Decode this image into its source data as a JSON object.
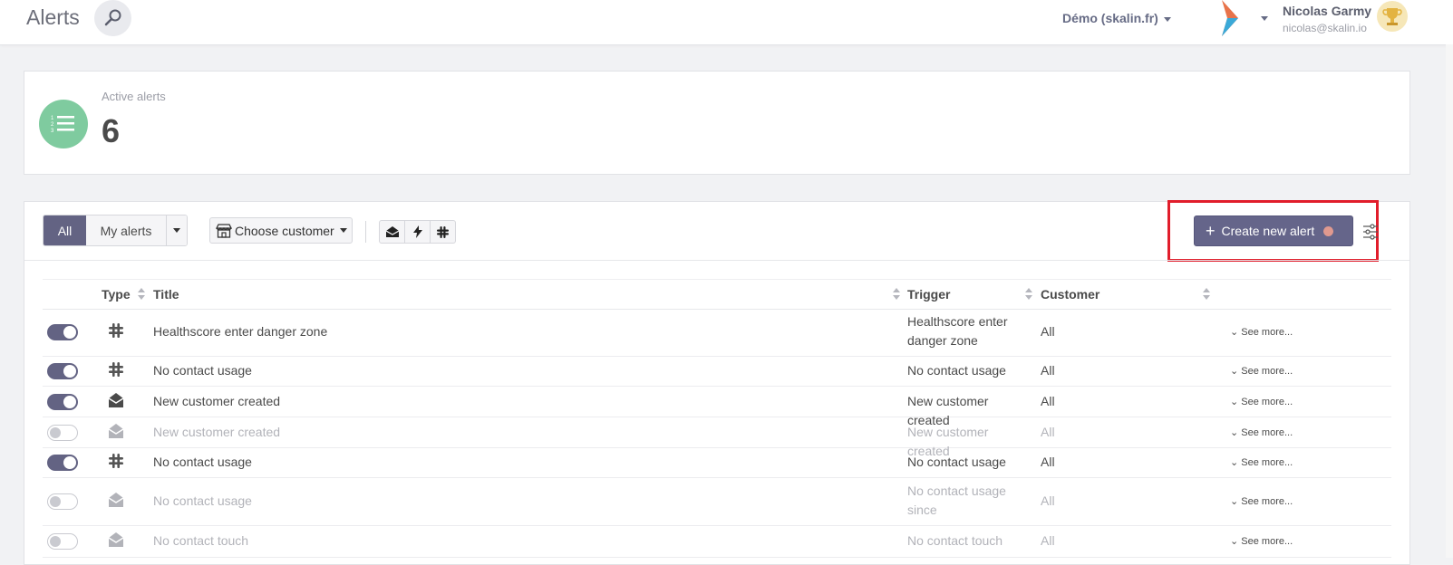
{
  "header": {
    "title": "Alerts",
    "workspace": "Démo (skalin.fr)",
    "user_name": "Nicolas Garmy",
    "user_email": "nicolas@skalin.io"
  },
  "stats": {
    "label": "Active alerts",
    "value": "6"
  },
  "toolbar": {
    "filter_all": "All",
    "filter_mine": "My alerts",
    "choose_customer": "Choose customer",
    "create_label": "Create new alert"
  },
  "table": {
    "columns": [
      "Type",
      "Title",
      "Trigger",
      "Customer"
    ],
    "see_more": "See more...",
    "rows": [
      {
        "enabled": true,
        "type": "slack-icon",
        "title": "Healthscore enter danger zone",
        "trigger": "Healthscore enter danger zone",
        "customer": "All"
      },
      {
        "enabled": true,
        "type": "slack-icon",
        "title": "No contact usage",
        "trigger": "No contact usage",
        "customer": "All"
      },
      {
        "enabled": true,
        "type": "email-icon",
        "title": "New customer created",
        "trigger": "New customer created",
        "customer": "All"
      },
      {
        "enabled": false,
        "type": "email-icon",
        "title": "New customer created",
        "trigger": "New customer created",
        "customer": "All"
      },
      {
        "enabled": true,
        "type": "slack-icon",
        "title": "No contact usage",
        "trigger": "No contact usage",
        "customer": "All"
      },
      {
        "enabled": false,
        "type": "email-icon",
        "title": "No contact usage",
        "trigger": "No contact usage since",
        "customer": "All"
      },
      {
        "enabled": false,
        "type": "email-icon",
        "title": "No contact touch",
        "trigger": "No contact touch",
        "customer": "All"
      }
    ]
  },
  "colors": {
    "accent": "#636383",
    "highlight": "#e11d2b",
    "stat_icon": "#7fcb9f"
  }
}
